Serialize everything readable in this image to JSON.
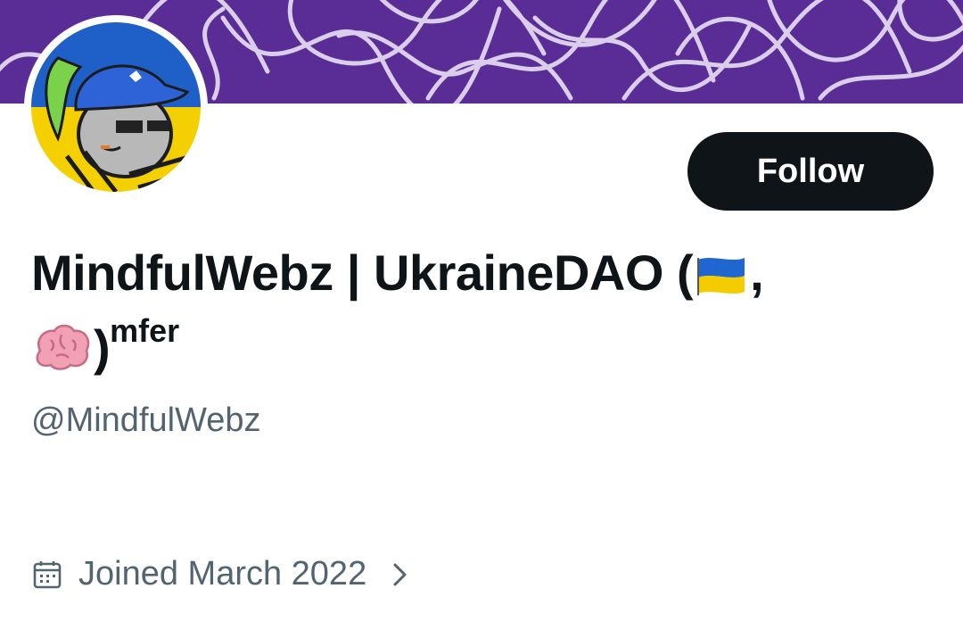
{
  "profile": {
    "display_name_main": "MindfulWebz | UkraineDAO (",
    "display_name_comma": ",",
    "display_name_close": ")",
    "display_name_superscript": "mfer",
    "handle": "@MindfulWebz",
    "joined": "Joined March 2022"
  },
  "actions": {
    "follow_label": "Follow"
  },
  "colors": {
    "banner": "#5a2d96",
    "button_bg": "#0f1419",
    "secondary_text": "#536471",
    "ukraine_blue": "#1f5fc8",
    "ukraine_yellow": "#f5d000"
  },
  "icons": {
    "flag": "ukraine-flag-icon",
    "brain": "brain-icon",
    "calendar": "calendar-icon",
    "chevron": "chevron-right-icon"
  }
}
